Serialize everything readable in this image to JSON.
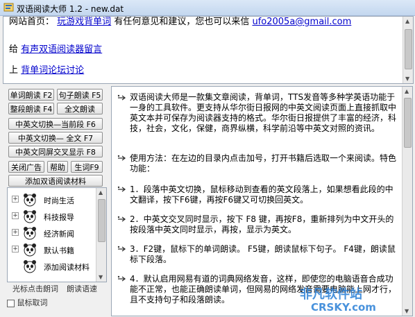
{
  "window": {
    "title": "双语阅读大师 1.2 - new.dat"
  },
  "top": {
    "line1_prefix": "网站首页：",
    "line1_link": "玩游戏背单词",
    "line1_middle": "有任何意见和建议，您也可以来信",
    "line1_email": "ufo2005a@gmail.com",
    "line2_prefix": "给",
    "line2_link": "有声双语阅读器留言",
    "line3_prefix": "上",
    "line3_link": "背单词论坛讨论"
  },
  "buttons": {
    "word_read": "单词朗读 F2",
    "sentence_read": "句子朗读 F5",
    "para_read": "整段朗读 F4",
    "full_read": "全文朗读",
    "toggle_current": "中英文切换—当前段  F6",
    "toggle_full": "中英文切换—  全文  F7",
    "side_by_side": "中英文同屏交叉显示  F8",
    "close_ad": "关闭广告",
    "help": "帮助",
    "new_words": "生词F9",
    "add_material": "添加双语阅读材料"
  },
  "tree": {
    "items": [
      {
        "label": "时尚生活"
      },
      {
        "label": "科技报导"
      },
      {
        "label": "经济新闻"
      },
      {
        "label": "默认书籍"
      },
      {
        "label": "添加阅读材料"
      }
    ]
  },
  "bottom_left": {
    "item1": "光标点击朗词",
    "item2": "朗读语速",
    "item3": "鼠标取词"
  },
  "content": {
    "paragraphs": [
      "双语阅读大师是一款集文章阅读，背单词，TTS发音等多种学英语功能于一身的工具软件。更支持从华尔街日报网的中英文阅读页面上直接抓取中英文本并可保存为阅读器支持的格式。华尔街日报提供了丰富的经济，科技，社会，文化，保健，商界纵横，科学前沿等中英文对照的资讯。",
      "使用方法：在左边的目录内点击加号，打开书籍后选取一个来阅读。特色功能：",
      "1．段落中英文切换，鼠标移动到查看的英文段落上，如果想看此段的中文翻译，按下F6键，再按F6键又可切换回英文。",
      "2．中英文交叉同时显示，按下 F8 键，再按F8，重新排列为中文开头的按段落中英文同时显示，再按，显示为英文。",
      "3．F2键，鼠标下的单词朗读。  F5键，朗读鼠标下句子。 F4键，朗读鼠标下段落。",
      "4．默认启用网易有道的词典网络发音，这样，即使您的电脑语音合成功能不正常，也能正确朗读单词，但网易的网络发音需要电脑能上网才行，且不支持句子和段落朗读。"
    ]
  },
  "watermark": {
    "top": "非凡软件站",
    "bottom": "CRSKY.com"
  }
}
